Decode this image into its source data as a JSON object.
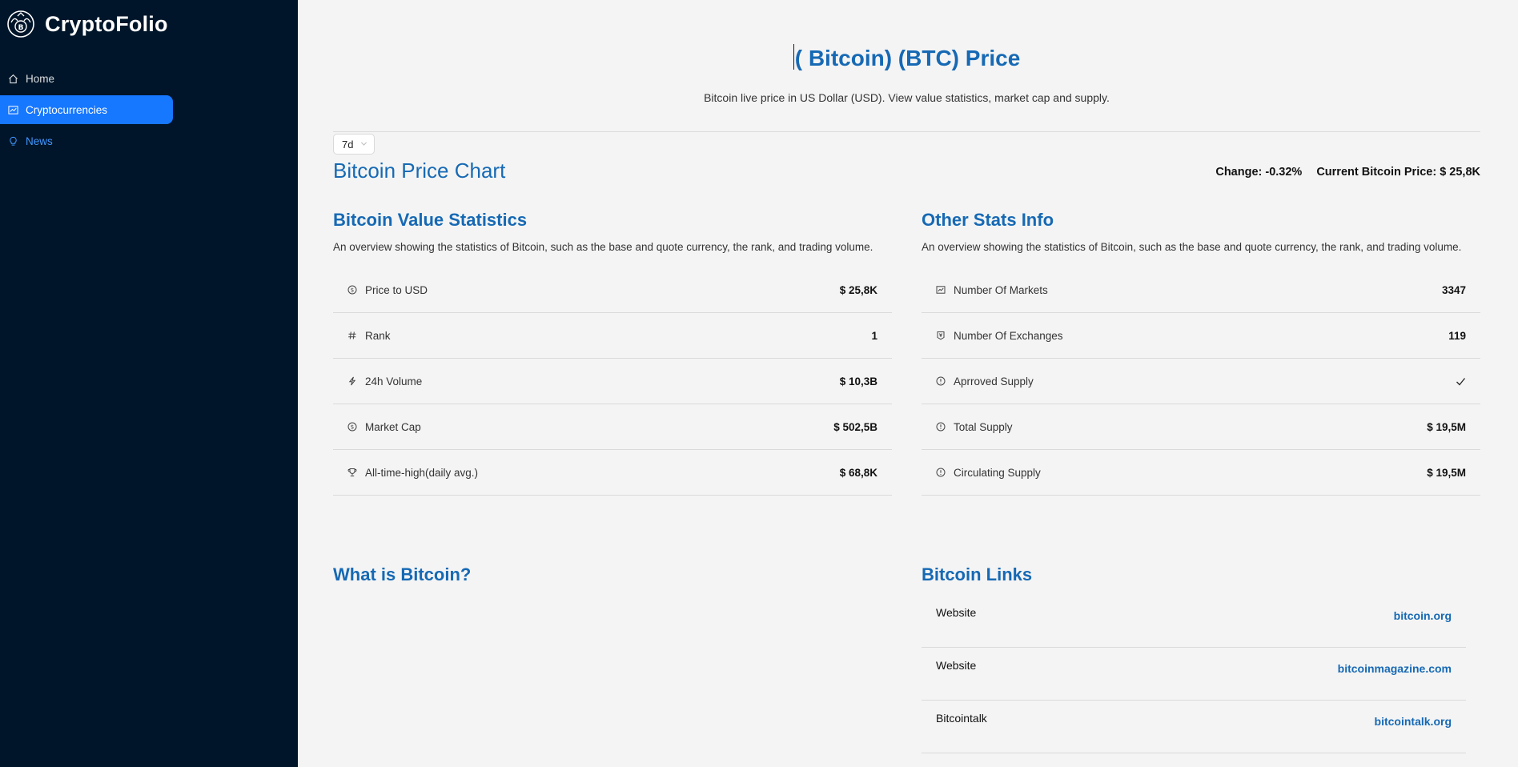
{
  "sidebar": {
    "brand": "CryptoFolio",
    "logo_icon": "bitcoin-logo-icon",
    "items": [
      {
        "label": "Home",
        "icon": "home-icon"
      },
      {
        "label": "Cryptocurrencies",
        "icon": "chart-icon",
        "active": true
      },
      {
        "label": "News",
        "icon": "bulb-icon"
      }
    ],
    "colors": {
      "background": "#001529",
      "active": "#1677ff",
      "link": "#4096ff"
    }
  },
  "header": {
    "title": "( Bitcoin) (BTC) Price",
    "subtitle": "Bitcoin live price in US Dollar (USD). View value statistics, market cap and supply."
  },
  "chart_controls": {
    "period": "7d",
    "chart_title": "Bitcoin Price Chart",
    "change": "Change: -0.32%",
    "current_price": "Current Bitcoin Price: $ 25,8K"
  },
  "value_stats": {
    "title": "Bitcoin Value Statistics",
    "description": "An overview showing the statistics of Bitcoin, such as the base and quote currency, the rank, and trading volume.",
    "rows": [
      {
        "label": "Price to USD",
        "value": "$ 25,8K",
        "icon": "dollar-circle-icon"
      },
      {
        "label": "Rank",
        "value": "1",
        "icon": "number-icon"
      },
      {
        "label": "24h Volume",
        "value": "$ 10,3B",
        "icon": "thunderbolt-icon"
      },
      {
        "label": "Market Cap",
        "value": "$ 502,5B",
        "icon": "dollar-circle-icon"
      },
      {
        "label": "All-time-high(daily avg.)",
        "value": "$ 68,8K",
        "icon": "trophy-icon"
      }
    ]
  },
  "other_stats": {
    "title": "Other Stats Info",
    "description": "An overview showing the statistics of Bitcoin, such as the base and quote currency, the rank, and trading volume.",
    "rows": [
      {
        "label": "Number Of Markets",
        "value": "3347",
        "icon": "fund-icon"
      },
      {
        "label": "Number Of Exchanges",
        "value": "119",
        "icon": "money-collect-icon"
      },
      {
        "label": "Aprroved Supply",
        "value": "",
        "icon": "exclamation-circle-icon",
        "value_icon": "check-icon"
      },
      {
        "label": "Total Supply",
        "value": "$ 19,5M",
        "icon": "exclamation-circle-icon"
      },
      {
        "label": "Circulating Supply",
        "value": "$ 19,5M",
        "icon": "exclamation-circle-icon"
      }
    ]
  },
  "about": {
    "title": "What is Bitcoin?"
  },
  "links": {
    "title": "Bitcoin Links",
    "rows": [
      {
        "type": "Website",
        "name": "bitcoin.org"
      },
      {
        "type": "Website",
        "name": "bitcoinmagazine.com"
      },
      {
        "type": "Bitcointalk",
        "name": "bitcointalk.org"
      }
    ]
  },
  "accent": "#1669b4"
}
